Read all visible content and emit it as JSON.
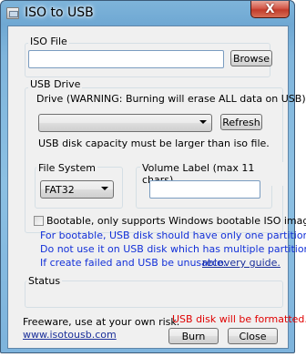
{
  "window": {
    "title": "ISO to USB",
    "close_glyph": "X"
  },
  "iso_file": {
    "legend": "ISO File",
    "path_value": "",
    "browse_label": "Browse"
  },
  "usb_drive": {
    "legend": "USB Drive",
    "drive_label": "Drive (WARNING: Burning will erase ALL data on USB)",
    "drive_selected": "",
    "refresh_label": "Refresh",
    "capacity_note": "USB disk capacity must be larger than iso file."
  },
  "file_system": {
    "legend": "File System",
    "selected": "FAT32"
  },
  "volume_label": {
    "legend": "Volume Label (max 11 chars)",
    "value": ""
  },
  "bootable": {
    "checked": false,
    "label": "Bootable, only supports Windows bootable ISO image.",
    "note_line1": "For bootable, USB disk should have only one partition.",
    "note_line2": "Do not use it on USB disk which has multiple partitions.",
    "note_line3": "If create failed and USB be unusable:",
    "recovery_link": "recovery guide."
  },
  "status": {
    "legend": "Status",
    "text": ""
  },
  "footer": {
    "freeware": "Freeware, use at your own risk.",
    "website": "www.isotousb.com",
    "warning": "USB disk will be formatted.",
    "burn_label": "Burn",
    "close_label": "Close"
  },
  "colors": {
    "warning_red": "#e00000",
    "note_blue": "#1230d8",
    "link_blue": "#1a2f9a"
  }
}
